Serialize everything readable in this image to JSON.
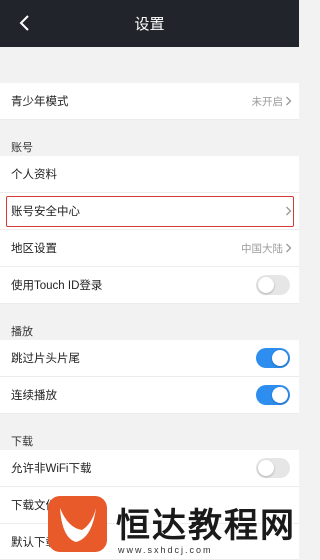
{
  "header": {
    "title": "设置",
    "back_icon": "chevron-left-icon"
  },
  "rows": {
    "teen_mode": {
      "label": "青少年模式",
      "value": "未开启"
    },
    "personal_info": {
      "label": "个人资料"
    },
    "account_security": {
      "label": "账号安全中心"
    },
    "region": {
      "label": "地区设置",
      "value": "中国大陆"
    },
    "touch_id": {
      "label": "使用Touch ID登录",
      "enabled": false
    },
    "skip_intro": {
      "label": "跳过片头片尾",
      "enabled": true
    },
    "autoplay": {
      "label": "连续播放",
      "enabled": true
    },
    "allow_non_wifi": {
      "label": "允许非WiFi下载",
      "enabled": false
    },
    "download_file": {
      "label": "下载文件"
    },
    "default_download": {
      "label": "默认下载"
    }
  },
  "sections": {
    "account": "账号",
    "playback": "播放",
    "download": "下载"
  },
  "colors": {
    "accent": "#2d8ef0",
    "highlight": "#d33b34",
    "navbar": "#21252b",
    "watermark_logo": "#e85a2a"
  },
  "watermark": {
    "text": "恒达教程网",
    "url": "www.sxhdcj.com"
  }
}
